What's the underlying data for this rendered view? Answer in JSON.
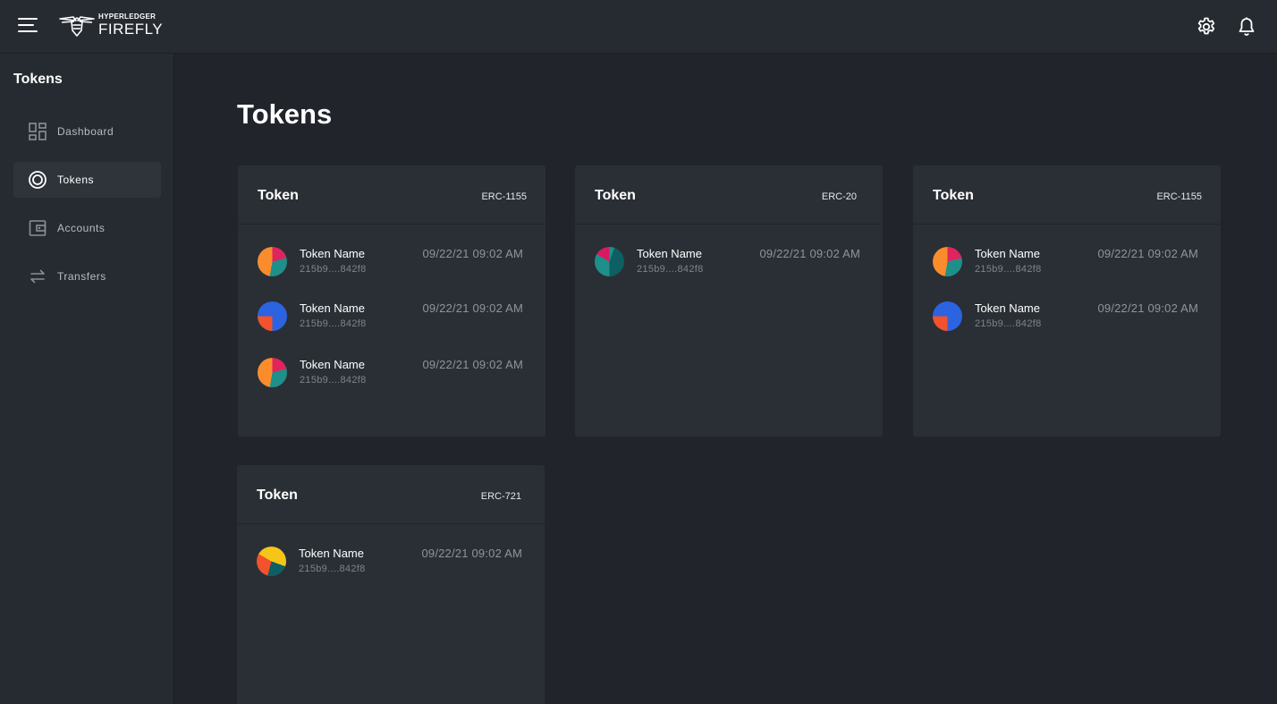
{
  "header": {
    "logo_top": "HYPERLEDGER",
    "logo_main": "FIREFLY",
    "menu_icon": "hamburger-menu-icon",
    "settings_icon": "gear-icon",
    "notifications_icon": "bell-icon"
  },
  "sidebar": {
    "title": "Tokens",
    "items": [
      {
        "label": "Dashboard",
        "icon": "dashboard-icon",
        "active": false
      },
      {
        "label": "Tokens",
        "icon": "tokens-icon",
        "active": true
      },
      {
        "label": "Accounts",
        "icon": "wallet-icon",
        "active": false
      },
      {
        "label": "Transfers",
        "icon": "transfer-arrows-icon",
        "active": false
      }
    ]
  },
  "main": {
    "title": "Tokens",
    "cards": [
      {
        "title": "Token",
        "type": "ERC-1155",
        "tokens": [
          {
            "name": "Token Name",
            "id": "215b9....842f8",
            "date": "09/22/21 09:02 AM",
            "avatar": "orange-teal-pink"
          },
          {
            "name": "Token Name",
            "id": "215b9....842f8",
            "date": "09/22/21 09:02 AM",
            "avatar": "blue-red"
          },
          {
            "name": "Token Name",
            "id": "215b9....842f8",
            "date": "09/22/21 09:02 AM",
            "avatar": "orange-teal-pink"
          }
        ]
      },
      {
        "title": "Token",
        "type": "ERC-20",
        "tokens": [
          {
            "name": "Token Name",
            "id": "215b9....842f8",
            "date": "09/22/21 09:02 AM",
            "avatar": "teal-pink"
          }
        ]
      },
      {
        "title": "Token",
        "type": "ERC-1155",
        "tokens": [
          {
            "name": "Token Name",
            "id": "215b9....842f8",
            "date": "09/22/21 09:02 AM",
            "avatar": "orange-teal-pink"
          },
          {
            "name": "Token Name",
            "id": "215b9....842f8",
            "date": "09/22/21 09:02 AM",
            "avatar": "blue-red"
          }
        ]
      },
      {
        "title": "Token",
        "type": "ERC-721",
        "tokens": [
          {
            "name": "Token Name",
            "id": "215b9....842f8",
            "date": "09/22/21 09:02 AM",
            "avatar": "yellow-red-teal"
          }
        ]
      }
    ]
  },
  "colors": {
    "background": "#21252b",
    "panel": "#262b31",
    "card": "#2a2f36",
    "active_item": "#2f343b",
    "muted_text": "#8e949b"
  }
}
